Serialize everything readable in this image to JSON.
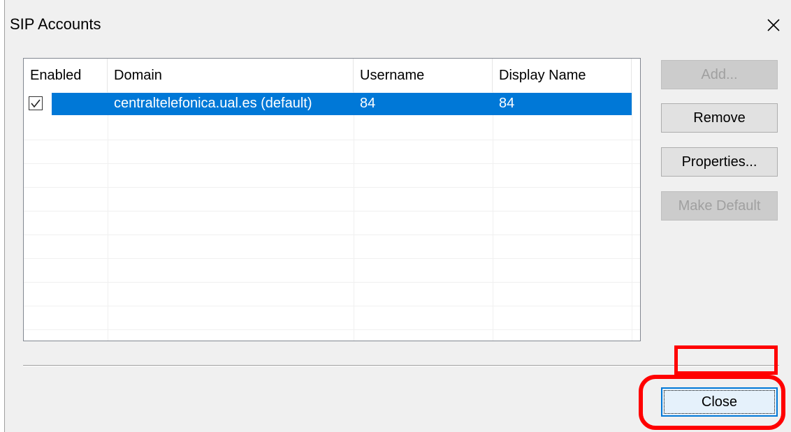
{
  "dialog": {
    "title": "SIP Accounts"
  },
  "list": {
    "columns": [
      "Enabled",
      "Domain",
      "Username",
      "Display Name"
    ],
    "rows": [
      {
        "enabled": true,
        "domain": "centraltelefonica.ual.es (default)",
        "username": "84",
        "display_name": "84"
      }
    ]
  },
  "buttons": {
    "add": "Add...",
    "remove": "Remove",
    "properties": "Properties...",
    "make_default": "Make Default",
    "close": "Close"
  },
  "colors": {
    "selection": "#0078d7",
    "annotation": "#ff0000"
  },
  "icons": {
    "close": "close-icon",
    "check": "checkmark-icon"
  }
}
